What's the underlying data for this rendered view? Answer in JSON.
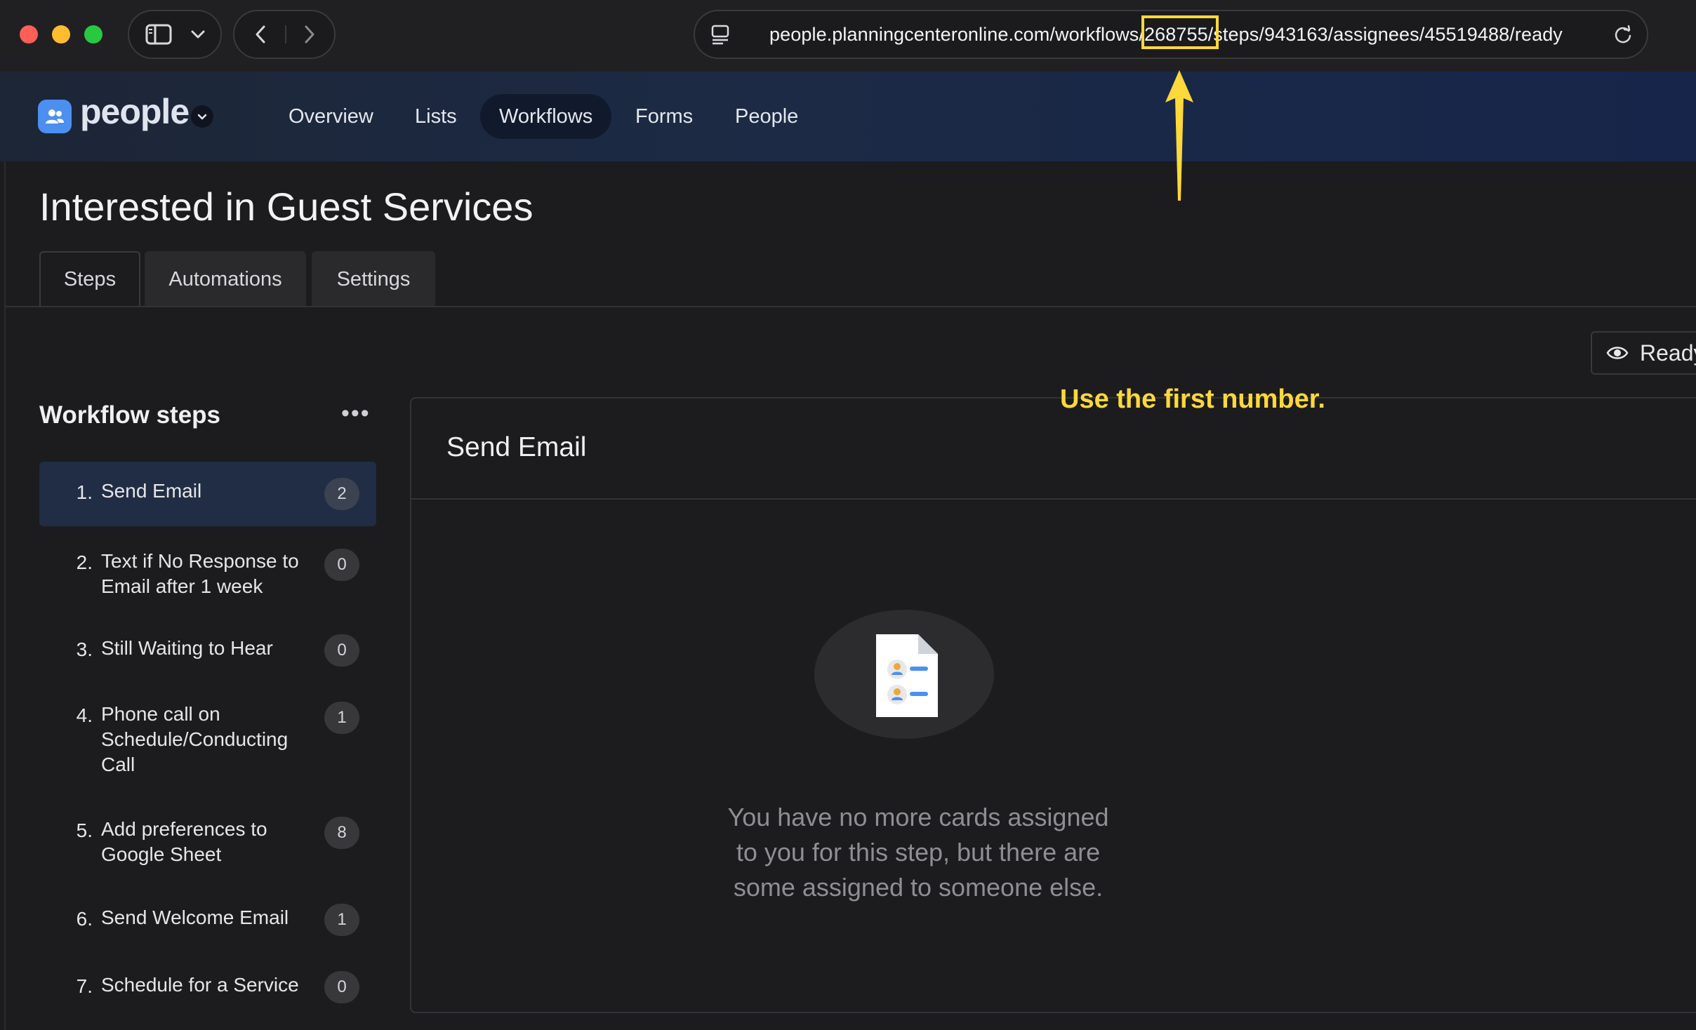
{
  "browser": {
    "url": "people.planningcenteronline.com/workflows/268755/steps/943163/assignees/45519488/ready",
    "url_before": "people.planningcenteronline.com/workflows/",
    "url_highlight": "268755",
    "url_after": "/steps/943163/assignees/45519488/ready"
  },
  "app": {
    "logo_text": "people",
    "nav": [
      {
        "label": "Overview"
      },
      {
        "label": "Lists"
      },
      {
        "label": "Workflows",
        "active": true
      },
      {
        "label": "Forms"
      },
      {
        "label": "People"
      }
    ]
  },
  "page": {
    "title": "Interested in Guest Services",
    "tabs": [
      {
        "label": "Steps",
        "active": true
      },
      {
        "label": "Automations"
      },
      {
        "label": "Settings"
      }
    ],
    "ready_button": "Ready"
  },
  "workflow_steps": {
    "heading": "Workflow steps",
    "menu_icon": "more-horizontal-icon",
    "steps": [
      {
        "number": "1.",
        "name": "Send Email",
        "count": "2",
        "active": true
      },
      {
        "number": "2.",
        "name": "Text if No Response to Email after 1 week",
        "count": "0"
      },
      {
        "number": "3.",
        "name": "Still Waiting to Hear",
        "count": "0"
      },
      {
        "number": "4.",
        "name": "Phone call on Schedule/Conducting Call",
        "count": "1"
      },
      {
        "number": "5.",
        "name": "Add preferences to Google Sheet",
        "count": "8"
      },
      {
        "number": "6.",
        "name": "Send Welcome Email",
        "count": "1"
      },
      {
        "number": "7.",
        "name": "Schedule for a Service",
        "count": "0"
      }
    ]
  },
  "detail": {
    "title": "Send Email",
    "empty_message": "You have no more cards assigned to you for this step, but there are some assigned to someone else."
  },
  "annotation": {
    "text": "Use the first number.",
    "color": "#ffd83b"
  },
  "colors": {
    "accent": "#4d8ff0",
    "active_step_bg": "#202d44",
    "header_gradient_end": "#17254a"
  }
}
